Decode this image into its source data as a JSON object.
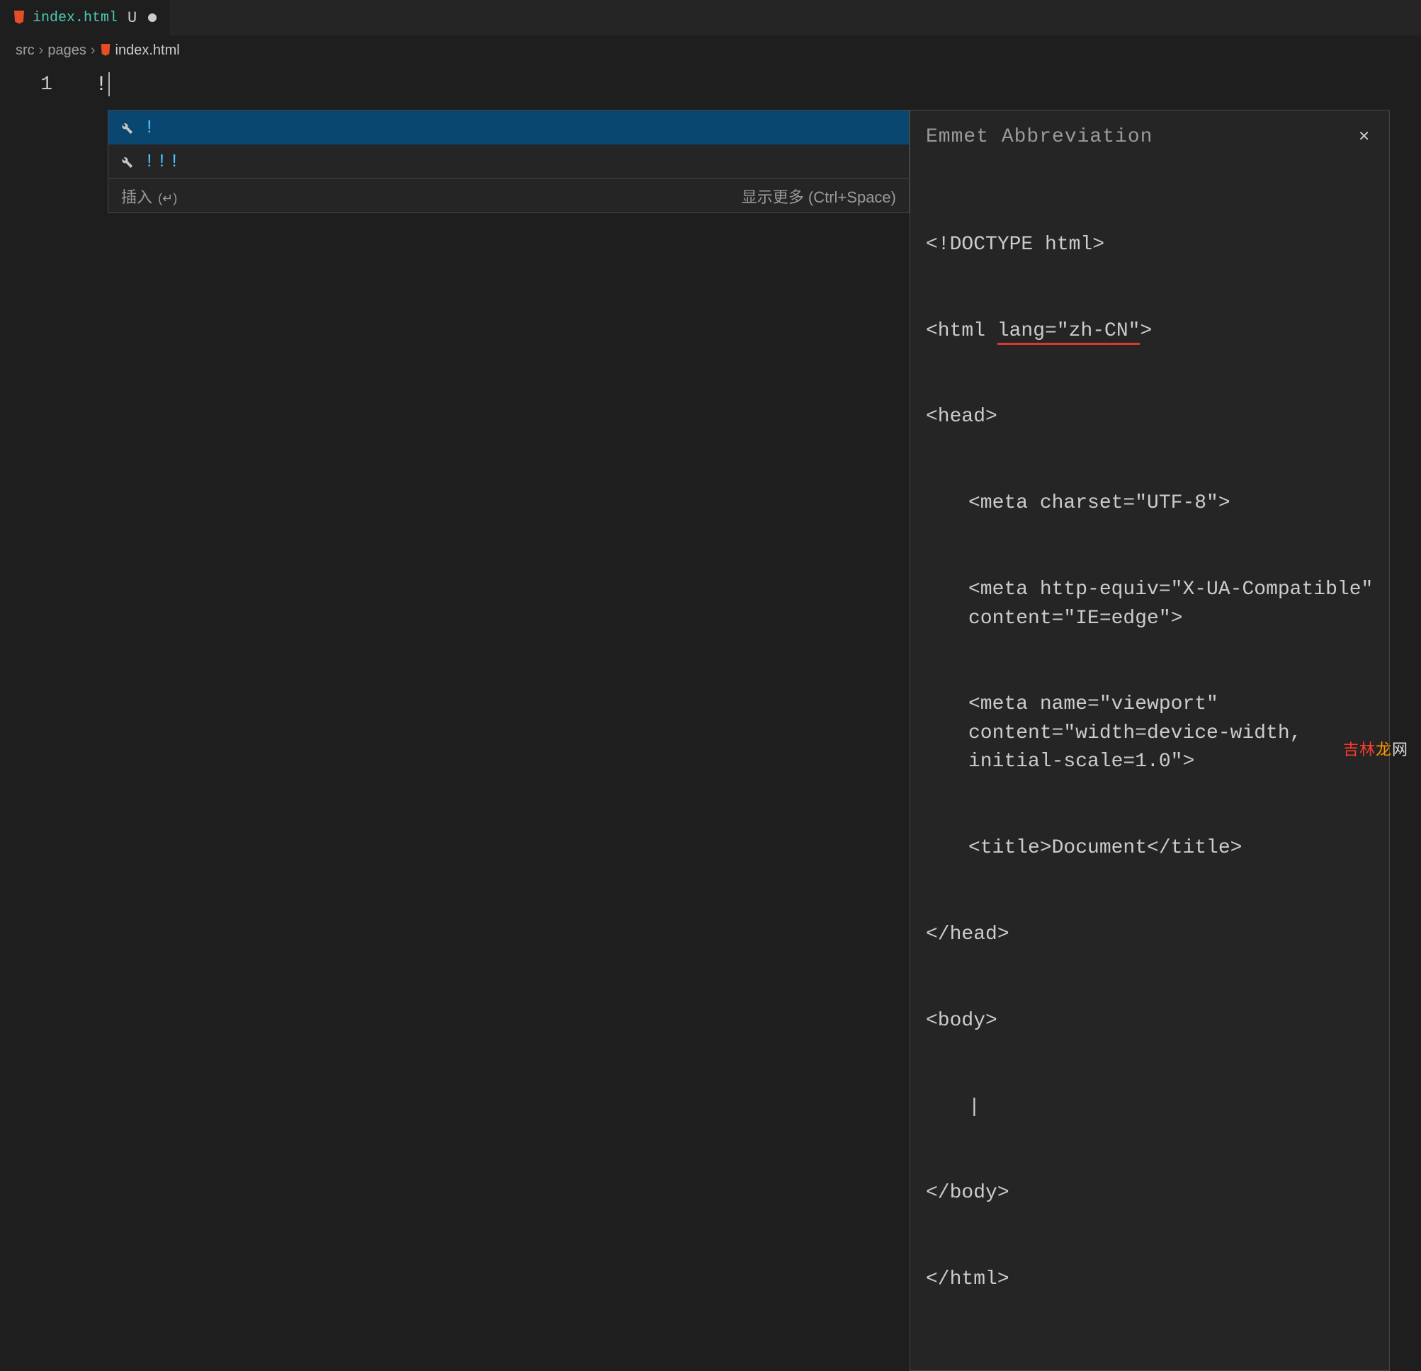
{
  "tab": {
    "filename": "index.html",
    "status": "U"
  },
  "breadcrumbs": {
    "parts": [
      "src",
      "pages",
      "index.html"
    ]
  },
  "editor": {
    "line_number": "1",
    "typed_text": "!"
  },
  "suggest": {
    "items": [
      {
        "label": "!"
      },
      {
        "label": "!!!"
      }
    ],
    "footer_left": "插入",
    "footer_left_hint": "(↵)",
    "footer_right": "显示更多 (Ctrl+Space)"
  },
  "doc": {
    "title": "Emmet Abbreviation",
    "lines": {
      "l1": "<!DOCTYPE html>",
      "l2a": "<html ",
      "l2b": "lang=\"zh-CN\"",
      "l2c": ">",
      "l3": "<head>",
      "l4": "<meta charset=\"UTF-8\">",
      "l5": "<meta http-equiv=\"X-UA-Compatible\" content=\"IE=edge\">",
      "l6": "<meta name=\"viewport\" content=\"width=device-width, initial-scale=1.0\">",
      "l7": "<title>Document</title>",
      "l8": "</head>",
      "l9": "<body>",
      "l10": "|",
      "l11": "</body>",
      "l12": "</html>"
    }
  },
  "watermark": {
    "a": "吉林",
    "b": "龙",
    "c": "网"
  }
}
